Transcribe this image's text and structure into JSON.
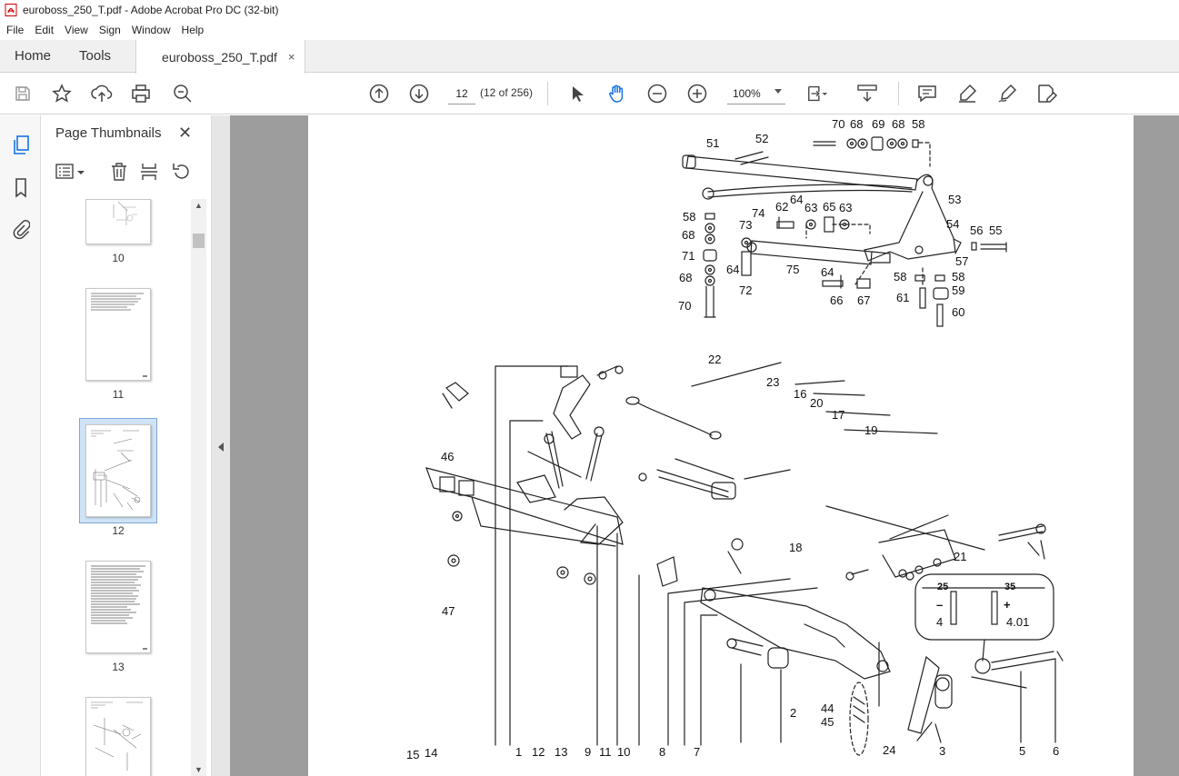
{
  "window": {
    "title": "euroboss_250_T.pdf - Adobe Acrobat Pro DC (32-bit)"
  },
  "menu": [
    "File",
    "Edit",
    "View",
    "Sign",
    "Window",
    "Help"
  ],
  "tabs": {
    "home": "Home",
    "tools": "Tools",
    "document": "euroboss_250_T.pdf",
    "close": "×"
  },
  "toolbar": {
    "page_number": "12",
    "page_count": "(12 of 256)",
    "zoom": "100%",
    "icons": [
      "save-icon",
      "bookmark-star-icon",
      "upload-icon",
      "print-icon",
      "search-zoom-icon",
      "page-up-icon",
      "page-down-icon",
      "select-arrow-icon",
      "hand-icon",
      "zoom-out-icon",
      "zoom-in-icon",
      "fit-page-icon",
      "scroll-mode-icon",
      "comment-icon",
      "highlight-icon",
      "sign-icon",
      "edit-icon"
    ]
  },
  "sidebar": {
    "title": "Page Thumbnails",
    "close": "✕",
    "thumbnails": [
      {
        "label": "10"
      },
      {
        "label": "11"
      },
      {
        "label": "12",
        "selected": true
      },
      {
        "label": "13"
      },
      {
        "label": ""
      }
    ]
  },
  "drawing": {
    "callouts_top": [
      "70",
      "68",
      "69",
      "68",
      "58",
      "51",
      "52",
      "74",
      "53",
      "54",
      "56",
      "55",
      "57",
      "58",
      "68",
      "71",
      "68",
      "70",
      "73",
      "64",
      "72",
      "62",
      "64",
      "63",
      "65",
      "63",
      "75",
      "64",
      "66",
      "67",
      "58",
      "58",
      "61",
      "59",
      "60"
    ],
    "callouts_bottom": [
      "22",
      "23",
      "16",
      "20",
      "17",
      "19",
      "46",
      "18",
      "21",
      "47",
      "25",
      "35",
      "4",
      "4.01",
      "44",
      "45",
      "2",
      "15",
      "14",
      "1",
      "12",
      "13",
      "9",
      "11",
      "10",
      "8",
      "7",
      "24",
      "3",
      "5",
      "6"
    ],
    "sign_minus": "–",
    "sign_plus": "+"
  }
}
